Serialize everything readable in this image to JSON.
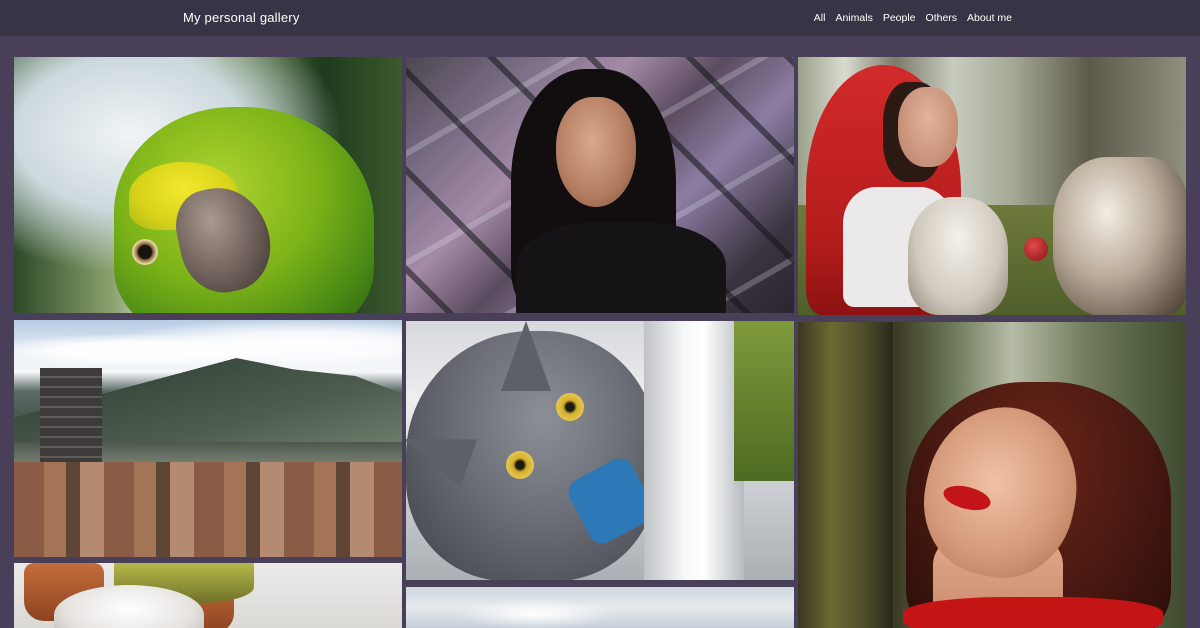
{
  "header": {
    "title": "My personal gallery",
    "nav": [
      "All",
      "Animals",
      "People",
      "Others",
      "About me"
    ]
  },
  "gallery": {
    "photos": [
      {
        "subject": "parrot"
      },
      {
        "subject": "woman-graffiti"
      },
      {
        "subject": "red-riding-hood-dogs"
      },
      {
        "subject": "city-hills"
      },
      {
        "subject": "gray-cat"
      },
      {
        "subject": "woman-forest"
      },
      {
        "subject": "white-dog"
      },
      {
        "subject": "sky"
      }
    ]
  },
  "colors": {
    "background": "#4a3f59",
    "header": "#383345",
    "header_text": "#ffffff"
  }
}
